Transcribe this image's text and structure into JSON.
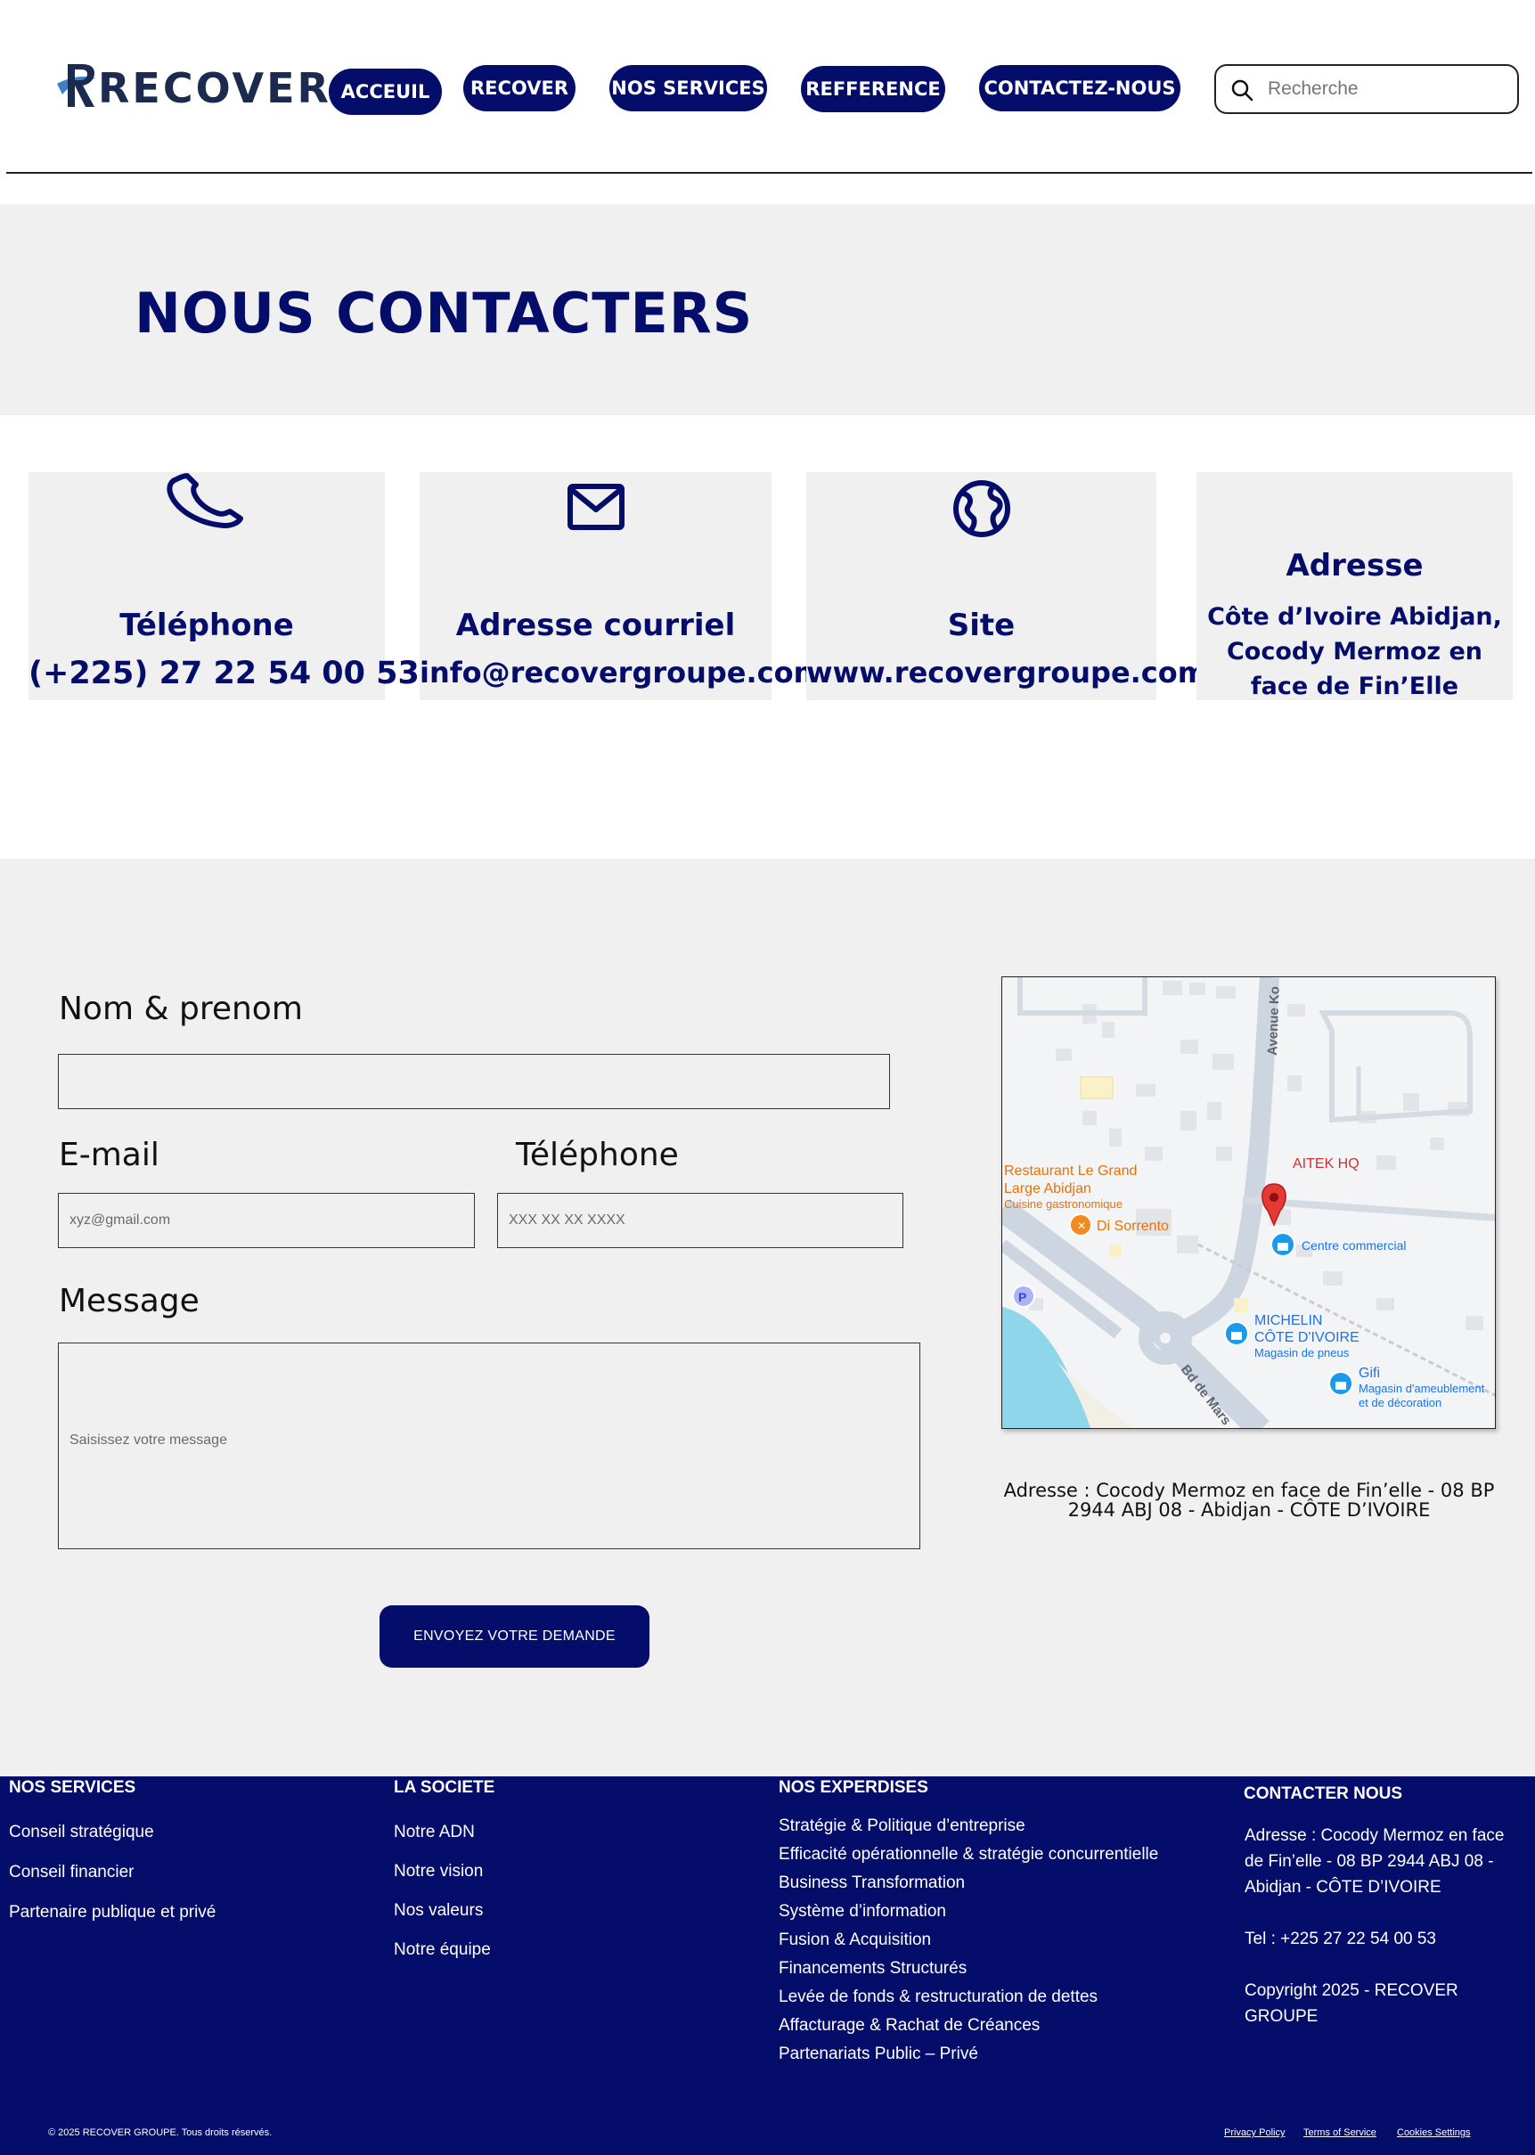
{
  "header": {
    "logo_text": "RECOVER",
    "nav": [
      "ACCEUIL",
      "RECOVER",
      "NOS SERVICES",
      "REFFERENCE",
      "CONTACTEZ-NOUS"
    ],
    "search_placeholder": "Recherche"
  },
  "hero": {
    "title": "NOUS CONTACTERS"
  },
  "cards": [
    {
      "icon": "phone-icon",
      "title": "Téléphone",
      "value": "(+225) 27 22 54 00 53"
    },
    {
      "icon": "mail-icon",
      "title": "Adresse courriel",
      "value": "info@recovergroupe.com"
    },
    {
      "icon": "globe-icon",
      "title": "Site",
      "value": "www.recovergroupe.com"
    },
    {
      "title": "Adresse",
      "value": "Côte d’Ivoire Abidjan, Cocody Mermoz en face de Fin’Elle"
    }
  ],
  "form": {
    "name_label": "Nom & prenom",
    "email_label": "E-mail",
    "email_placeholder": "xyz@gmail.com",
    "phone_label": "Téléphone",
    "phone_placeholder": "XXX XX XX XXXX",
    "message_label": "Message",
    "message_placeholder": "Saisissez votre message",
    "submit_label": "ENVOYEZ VOTRE DEMANDE"
  },
  "map": {
    "street_1": "Avenue Ko",
    "street_2": "Bd de Mars",
    "restaurant_1_name": "Restaurant Le Grand Large Abidjan",
    "restaurant_1_type": "Cuisine gastronomique",
    "restaurant_2_name": "Di Sorrento",
    "hq_label": "AITEK HQ",
    "shop_1_name": "Centre commercial",
    "shop_2_name": "MICHELIN CÔTE D'IVOIRE",
    "shop_2_type": "Magasin de pneus",
    "shop_3_name": "Gifi",
    "shop_3_type": "Magasin d'ameublement et de décoration",
    "parking": "P"
  },
  "map_address": "Adresse : Cocody Mermoz en face de Fin’elle - 08 BP 2944 ABJ 08 - Abidjan - CÔTE D’IVOIRE",
  "footer": {
    "services_title": "NOS SERVICES",
    "services": [
      "Conseil stratégique",
      "Conseil financier",
      "Partenaire publique et privé"
    ],
    "societe_title": "LA SOCIETE",
    "societe": [
      "Notre ADN",
      "Notre vision",
      "Nos valeurs",
      "Notre équipe"
    ],
    "expertises_title": "NOS EXPERDISES",
    "expertises": [
      "Stratégie & Politique d’entreprise",
      "Efficacité opérationnelle & stratégie concurrentielle",
      "Business Transformation",
      "Système d’information",
      "Fusion & Acquisition",
      "Financements Structurés",
      "Levée de fonds & restructuration de dettes",
      "Affacturage & Rachat de Créances",
      "Partenariats Public – Privé"
    ],
    "contact_title": "CONTACTER NOUS",
    "contact_address": "Adresse : Cocody Mermoz en face de Fin’elle - 08 BP 2944 ABJ 08 - Abidjan - CÔTE D’IVOIRE",
    "contact_tel": "Tel : +225 27 22 54 00 53",
    "contact_copyright": "Copyright 2025 - RECOVER GROUPE",
    "bottom_copyright": "© 2025 RECOVER GROUPE. Tous droits réservés.",
    "legal": [
      "Privacy Policy",
      "Terms of Service",
      "Cookies Settings"
    ]
  },
  "colors": {
    "brand_navy": "#050d6b",
    "section_gray": "#f0f0f0"
  }
}
